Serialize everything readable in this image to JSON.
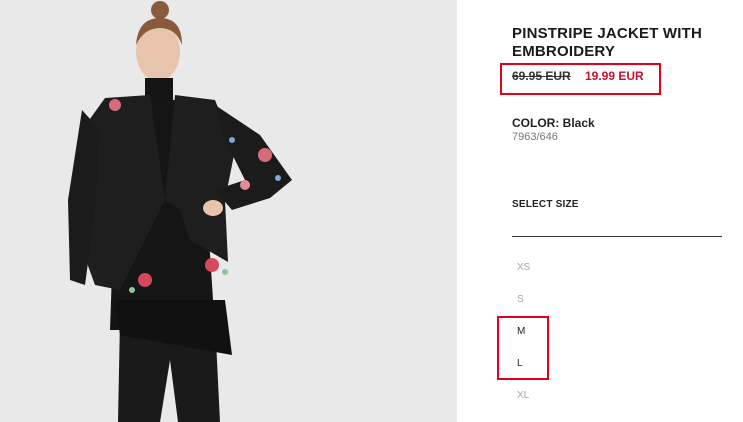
{
  "product": {
    "title": "PINSTRIPE JACKET WITH EMBROIDERY",
    "old_price": "69.95 EUR",
    "new_price": "19.99 EUR",
    "color_label": "COLOR: Black",
    "reference": "7963/646"
  },
  "size_selector": {
    "label": "SELECT SIZE",
    "sizes": [
      {
        "label": "XS",
        "available": false
      },
      {
        "label": "S",
        "available": false
      },
      {
        "label": "M",
        "available": true
      },
      {
        "label": "L",
        "available": true
      },
      {
        "label": "XL",
        "available": false
      }
    ]
  },
  "colors": {
    "highlight": "#e3001b",
    "sale_price": "#c8102e",
    "photo_background": "#e8e8e8"
  }
}
